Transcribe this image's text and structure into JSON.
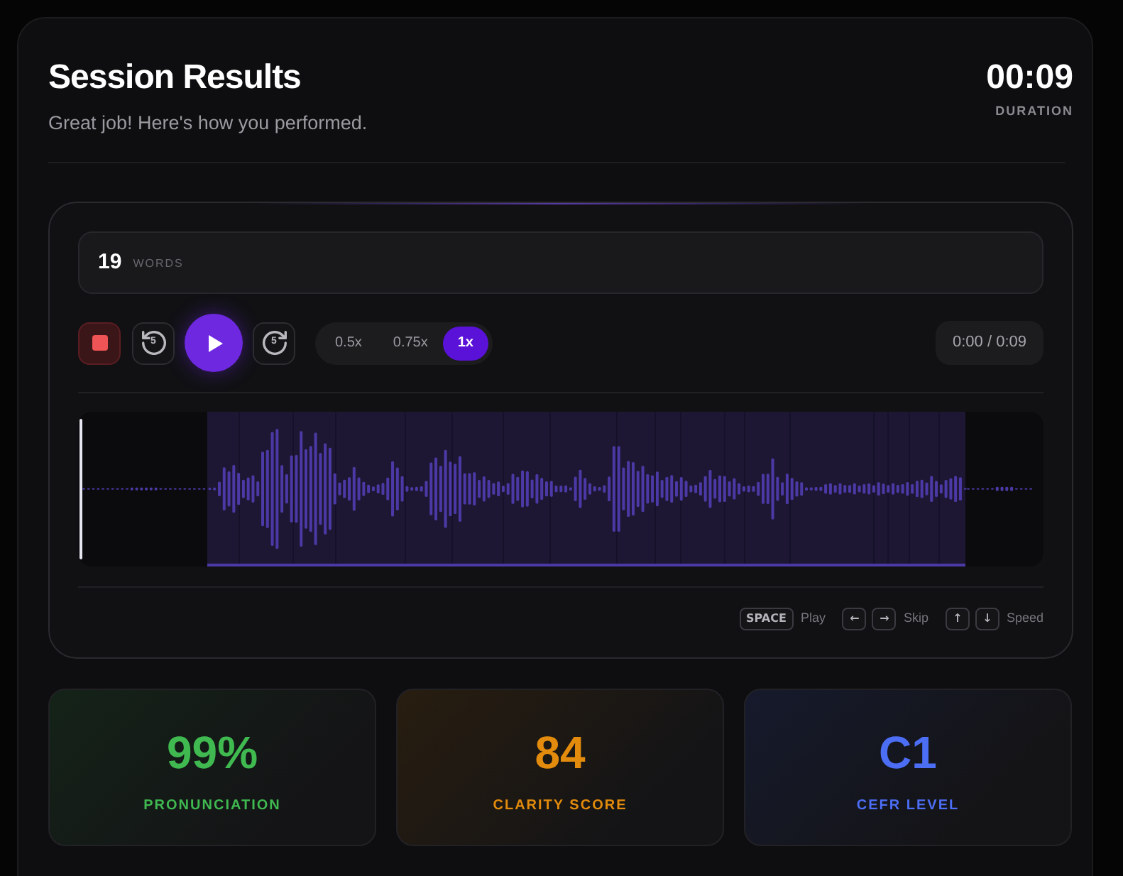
{
  "header": {
    "title": "Session Results",
    "subtitle": "Great job! Here's how you performed.",
    "duration": "00:09",
    "duration_label": "DURATION"
  },
  "player": {
    "word_count": "19",
    "word_label": "WORDS",
    "skip_back": "5",
    "skip_forward": "5",
    "playing": false,
    "speeds": [
      {
        "label": "0.5x",
        "selected": false
      },
      {
        "label": "0.75x",
        "selected": false
      },
      {
        "label": "1x",
        "selected": true
      }
    ],
    "time": "0:00 / 0:09"
  },
  "shortcuts": [
    {
      "keys": [
        "SPACE"
      ],
      "action": "Play"
    },
    {
      "keys": [
        "←",
        "→"
      ],
      "action": "Skip"
    },
    {
      "keys": [
        "↑",
        "↓"
      ],
      "action": "Speed"
    }
  ],
  "stats": [
    {
      "value": "99%",
      "label": "PRONUNCIATION",
      "color": "#3fb950"
    },
    {
      "value": "84",
      "label": "CLARITY SCORE",
      "color": "#e38b0c"
    },
    {
      "value": "C1",
      "label": "CEFR LEVEL",
      "color": "#4c6ef5"
    }
  ]
}
